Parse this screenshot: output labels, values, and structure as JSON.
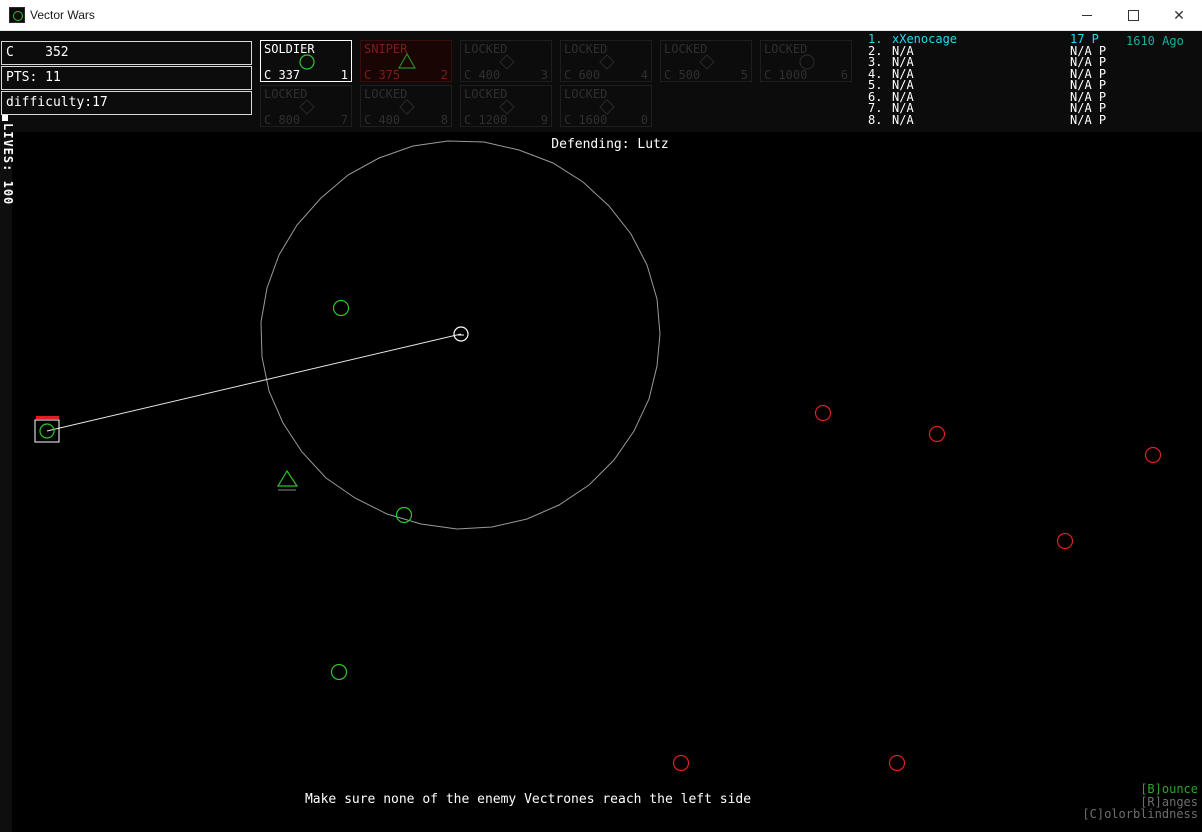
{
  "window": {
    "title": "Vector Wars"
  },
  "hud": {
    "credits_label": "C",
    "credits": "352",
    "points_label": "PTS:",
    "points": "11",
    "difficulty_label": "difficulty:",
    "difficulty": "17",
    "lives_label": "LIVES:",
    "lives": "100"
  },
  "units": [
    {
      "name": "SOLDIER",
      "cost": "C 337",
      "key": "1",
      "state": "selected",
      "icon": "circle-icon"
    },
    {
      "name": "SNIPER",
      "cost": "C 375",
      "key": "2",
      "state": "unaffordable",
      "icon": "triangle-icon"
    },
    {
      "name": "LOCKED",
      "cost": "C 400",
      "key": "3",
      "state": "locked",
      "icon": "diamond-icon"
    },
    {
      "name": "LOCKED",
      "cost": "C 600",
      "key": "4",
      "state": "locked",
      "icon": "diamond-icon"
    },
    {
      "name": "LOCKED",
      "cost": "C 500",
      "key": "5",
      "state": "locked",
      "icon": "diamond-icon"
    },
    {
      "name": "LOCKED",
      "cost": "C 1000",
      "key": "6",
      "state": "locked",
      "icon": "circle-icon"
    },
    {
      "name": "LOCKED",
      "cost": "C 800",
      "key": "7",
      "state": "locked",
      "icon": "diamond-icon"
    },
    {
      "name": "LOCKED",
      "cost": "C 400",
      "key": "8",
      "state": "locked",
      "icon": "diamond-icon"
    },
    {
      "name": "LOCKED",
      "cost": "C 1200",
      "key": "9",
      "state": "locked",
      "icon": "diamond-icon"
    },
    {
      "name": "LOCKED",
      "cost": "C 1600",
      "key": "0",
      "state": "locked",
      "icon": "diamond-icon"
    }
  ],
  "leaderboard": [
    {
      "rank": "1.",
      "name": "xXenocage",
      "score": "17 P"
    },
    {
      "rank": "2.",
      "name": "N/A",
      "score": "N/A P"
    },
    {
      "rank": "3.",
      "name": "N/A",
      "score": "N/A P"
    },
    {
      "rank": "4.",
      "name": "N/A",
      "score": "N/A P"
    },
    {
      "rank": "5.",
      "name": "N/A",
      "score": "N/A P"
    },
    {
      "rank": "6.",
      "name": "N/A",
      "score": "N/A P"
    },
    {
      "rank": "7.",
      "name": "N/A",
      "score": "N/A P"
    },
    {
      "rank": "8.",
      "name": "N/A",
      "score": "N/A P"
    }
  ],
  "timer": "1610 Ago",
  "defending": "Defending: Lutz",
  "hint": "Make sure none of the enemy Vectrones reach the left side",
  "controls": {
    "bounce": "[B]ounce",
    "ranges": "[R]anges",
    "colorblind": "[C]olorblindness"
  },
  "colors": {
    "friendly": "#2ec42e",
    "enemy": "#e02020",
    "leader": "#27d7f2",
    "range": "#9a9a9a"
  }
}
